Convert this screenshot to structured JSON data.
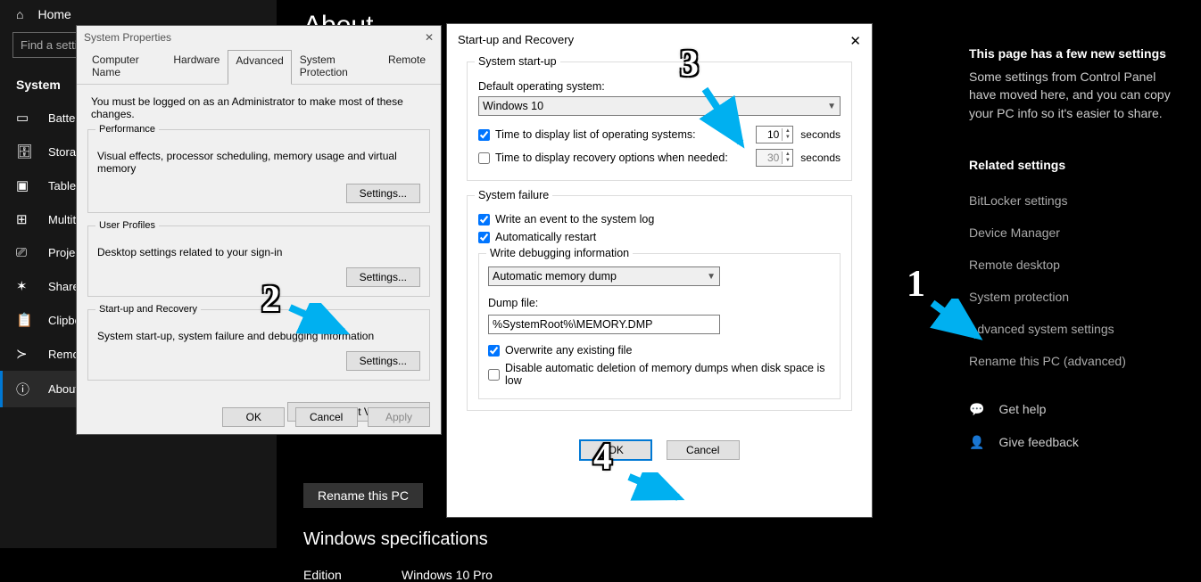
{
  "sidebar": {
    "home": "Home",
    "search_placeholder": "Find a setting",
    "category": "System",
    "items": [
      {
        "icon": "🔋",
        "label": "Battery"
      },
      {
        "icon": "💾",
        "label": "Storage"
      },
      {
        "icon": "📱",
        "label": "Tablet"
      },
      {
        "icon": "🗂",
        "label": "Multitasking"
      },
      {
        "icon": "🖥",
        "label": "Projecting to this PC"
      },
      {
        "icon": "✂",
        "label": "Shared experiences"
      },
      {
        "icon": "📋",
        "label": "Clipboard"
      },
      {
        "icon": "⟲",
        "label": "Remote Desktop"
      },
      {
        "icon": "ⓘ",
        "label": "About"
      }
    ]
  },
  "main": {
    "title": "About",
    "rename_btn": "Rename this PC",
    "win_spec_hdr": "Windows specifications",
    "edition_label": "Edition",
    "edition_value": "Windows 10 Pro"
  },
  "right": {
    "hdr": "This page has a few new settings",
    "desc": "Some settings from Control Panel have moved here, and you can copy your PC info so it's easier to share.",
    "rs_hdr": "Related settings",
    "links": [
      "BitLocker settings",
      "Device Manager",
      "Remote desktop",
      "System protection",
      "Advanced system settings",
      "Rename this PC (advanced)"
    ],
    "help": "Get help",
    "feedback": "Give feedback"
  },
  "dlg1": {
    "title": "System Properties",
    "tabs": [
      "Computer Name",
      "Hardware",
      "Advanced",
      "System Protection",
      "Remote"
    ],
    "admin_note": "You must be logged on as an Administrator to make most of these changes.",
    "perf": {
      "legend": "Performance",
      "desc": "Visual effects, processor scheduling, memory usage and virtual memory",
      "btn": "Settings..."
    },
    "prof": {
      "legend": "User Profiles",
      "desc": "Desktop settings related to your sign-in",
      "btn": "Settings..."
    },
    "startup": {
      "legend": "Start-up and Recovery",
      "desc": "System start-up, system failure and debugging information",
      "btn": "Settings..."
    },
    "env_btn": "Environment Variables...",
    "ok": "OK",
    "cancel": "Cancel",
    "apply": "Apply"
  },
  "dlg2": {
    "title": "Start-up and Recovery",
    "startup_legend": "System start-up",
    "default_os_label": "Default operating system:",
    "default_os": "Windows 10",
    "time_list_label": "Time to display list of operating systems:",
    "time_list_val": "10",
    "time_rec_label": "Time to display recovery options when needed:",
    "time_rec_val": "30",
    "seconds": "seconds",
    "failure_legend": "System failure",
    "write_event": "Write an event to the system log",
    "auto_restart": "Automatically restart",
    "debug_legend": "Write debugging information",
    "debug_select": "Automatic memory dump",
    "dump_label": "Dump file:",
    "dump_value": "%SystemRoot%\\MEMORY.DMP",
    "overwrite": "Overwrite any existing file",
    "disable_del": "Disable automatic deletion of memory dumps when disk space is low",
    "ok": "OK",
    "cancel": "Cancel"
  },
  "annot": {
    "n1": "1",
    "n2": "2",
    "n3": "3",
    "n4": "4"
  }
}
